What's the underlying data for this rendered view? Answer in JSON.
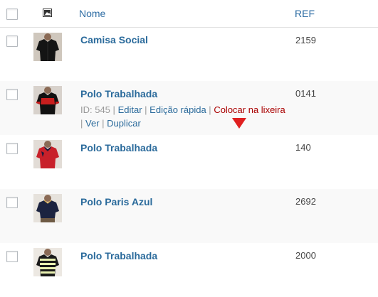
{
  "header": {
    "name_col": "Nome",
    "ref_col": "REF",
    "image_col_icon": "image-icon"
  },
  "rows": [
    {
      "title": "Camisa Social",
      "ref": "2159",
      "shirt": "black-dress-shirt"
    },
    {
      "title": "Polo Trabalhada",
      "ref": "0141",
      "shirt": "black-red-polo",
      "actions": {
        "id": "ID: 545",
        "sep": "|",
        "edit": "Editar",
        "quick_edit": "Edição rápida",
        "trash": "Colocar na lixeira",
        "view": "Ver",
        "duplicate": "Duplicar"
      }
    },
    {
      "title": "Polo Trabalhada",
      "ref": "140",
      "shirt": "red-polo"
    },
    {
      "title": "Polo Paris Azul",
      "ref": "2692",
      "shirt": "navy-polo"
    },
    {
      "title": "Polo Trabalhada",
      "ref": "2000",
      "shirt": "striped-polo"
    }
  ],
  "colors": {
    "link": "#2a6a9b",
    "trash": "#aa0000",
    "arrow": "#e02020"
  }
}
